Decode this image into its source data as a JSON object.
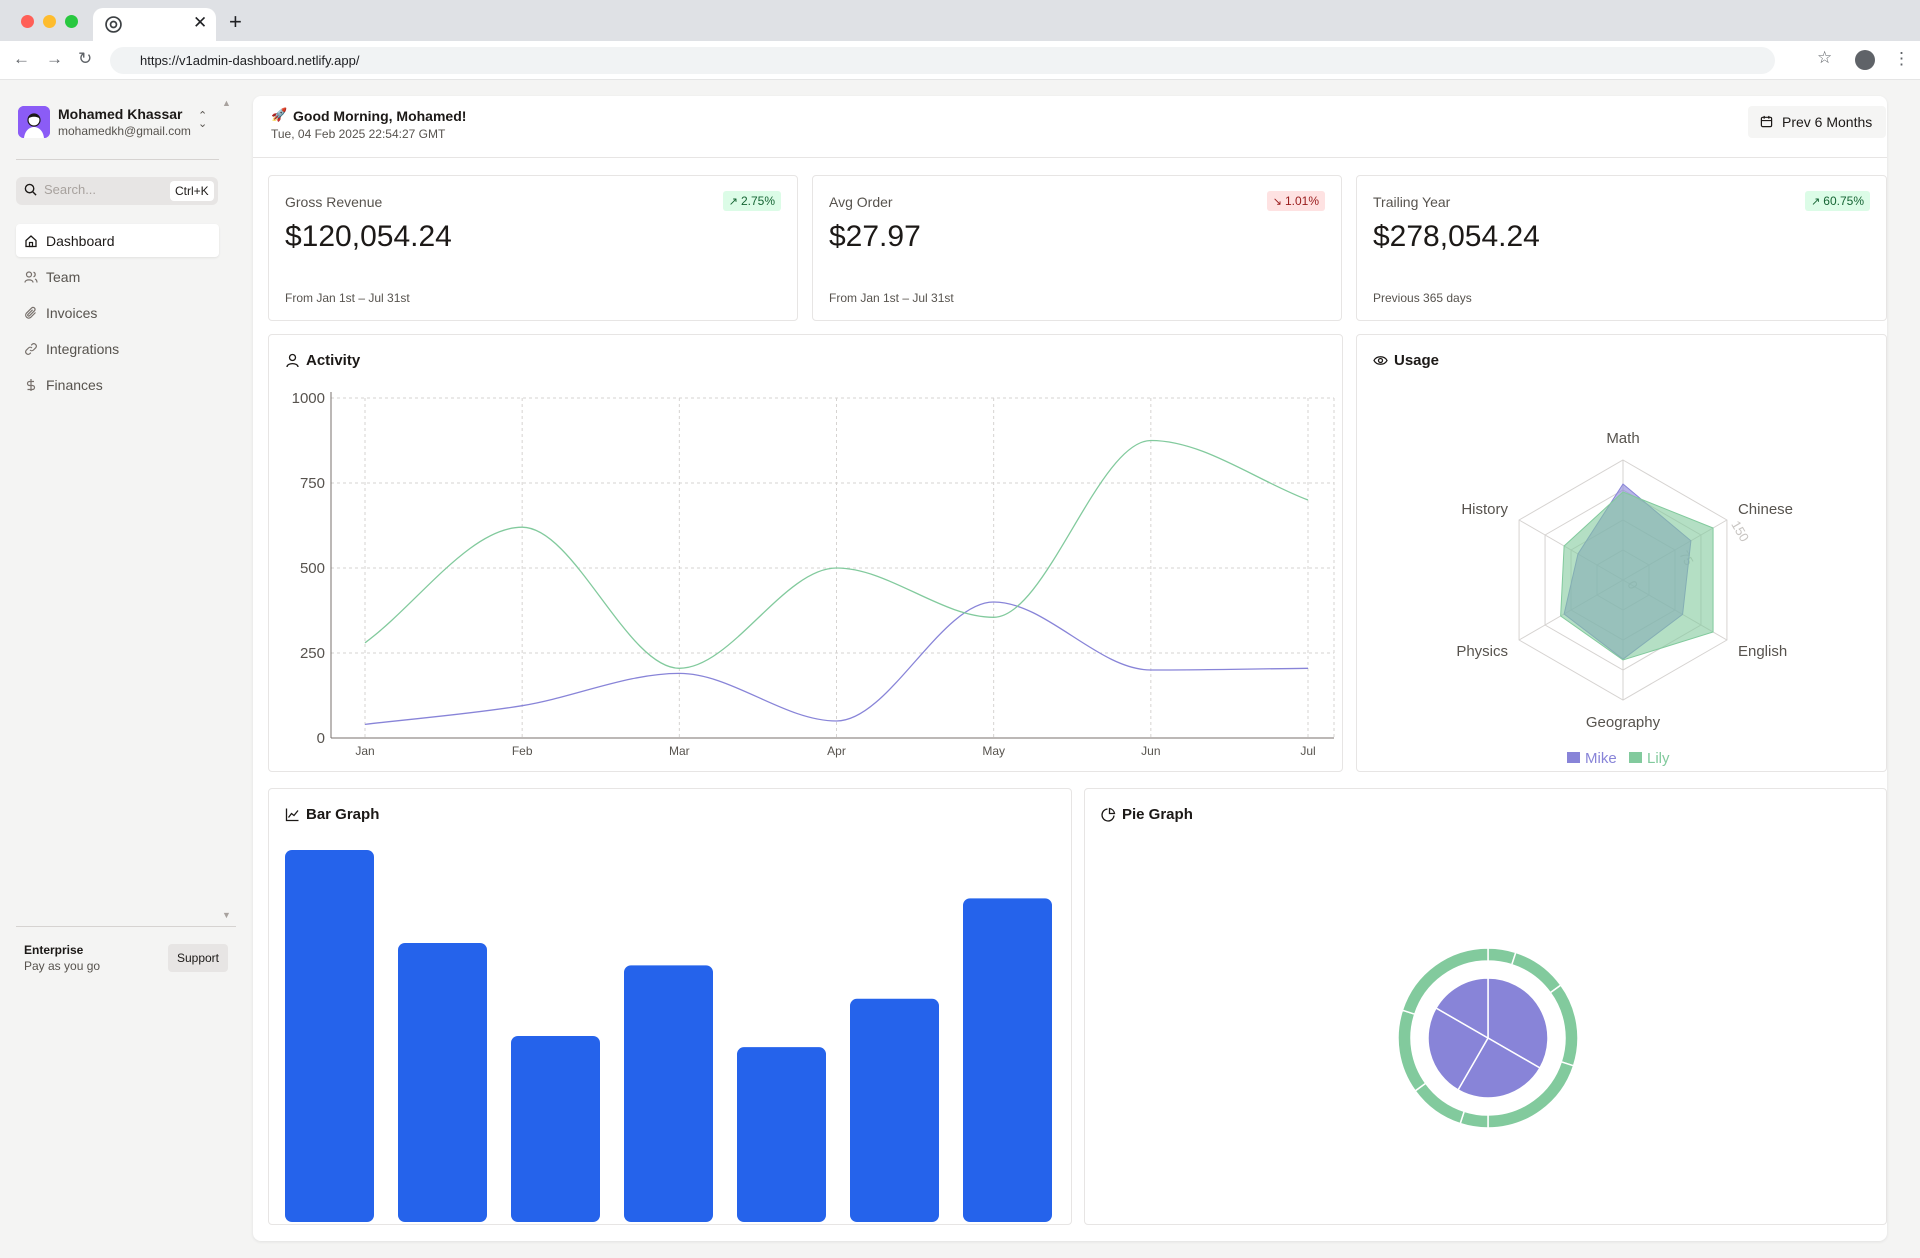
{
  "browser": {
    "url": "https://v1admin-dashboard.netlify.app/",
    "traffic_colors": [
      "#ff5f57",
      "#febc2e",
      "#28c840"
    ]
  },
  "sidebar": {
    "user": {
      "name": "Mohamed Khassar",
      "email": "mohamedkh@gmail.com"
    },
    "search": {
      "placeholder": "Search...",
      "shortcut": "Ctrl+K"
    },
    "items": [
      {
        "label": "Dashboard",
        "icon": "home-icon",
        "active": true
      },
      {
        "label": "Team",
        "icon": "users-icon",
        "active": false
      },
      {
        "label": "Invoices",
        "icon": "paperclip-icon",
        "active": false
      },
      {
        "label": "Integrations",
        "icon": "link-icon",
        "active": false
      },
      {
        "label": "Finances",
        "icon": "dollar-icon",
        "active": false
      }
    ],
    "plan": {
      "title": "Enterprise",
      "subtitle": "Pay as you go",
      "support_label": "Support"
    }
  },
  "header": {
    "greeting": "Good Morning, Mohamed!",
    "date": "Tue, 04 Feb 2025 22:54:27 GMT",
    "range_button": "Prev 6 Months"
  },
  "stats": [
    {
      "label": "Gross Revenue",
      "value": "$120,054.24",
      "note": "From Jan 1st – Jul 31st",
      "change": "2.75%",
      "trend": "up"
    },
    {
      "label": "Avg Order",
      "value": "$27.97",
      "note": "From Jan 1st – Jul 31st",
      "change": "1.01%",
      "trend": "down"
    },
    {
      "label": "Trailing Year",
      "value": "$278,054.24",
      "note": "Previous 365 days",
      "change": "60.75%",
      "trend": "up"
    }
  ],
  "activity": {
    "title": "Activity"
  },
  "usage": {
    "title": "Usage"
  },
  "bar_graph": {
    "title": "Bar Graph"
  },
  "pie_graph": {
    "title": "Pie Graph"
  },
  "colors": {
    "purple": "#8884d8",
    "green": "#82ca9d",
    "blue": "#2563eb"
  },
  "chart_data": [
    {
      "type": "line",
      "x": [
        "Jan",
        "Feb",
        "Mar",
        "Apr",
        "May",
        "Jun",
        "Jul"
      ],
      "ylim": [
        0,
        1000
      ],
      "yticks": [
        0,
        250,
        500,
        750,
        1000
      ],
      "grid": true,
      "series": [
        {
          "values": [
            40,
            95,
            190,
            50,
            400,
            200,
            205
          ],
          "color": "#8884d8"
        },
        {
          "values": [
            280,
            620,
            205,
            500,
            355,
            875,
            700
          ],
          "color": "#82ca9d"
        }
      ]
    },
    {
      "type": "radar",
      "axes": [
        "Math",
        "Chinese",
        "English",
        "Geography",
        "Physics",
        "History"
      ],
      "rlim": [
        0,
        150
      ],
      "rticks": [
        0,
        75,
        150
      ],
      "legend": "bottom",
      "series": [
        {
          "name": "Mike",
          "values": [
            120,
            98,
            86,
            99,
            85,
            65
          ],
          "color": "#8884d8"
        },
        {
          "name": "Lily",
          "values": [
            110,
            130,
            130,
            100,
            90,
            85
          ],
          "color": "#82ca9d"
        }
      ]
    },
    {
      "type": "bar",
      "values": [
        1000,
        750,
        500,
        690,
        470,
        600,
        870
      ],
      "color": "#2563eb"
    },
    {
      "type": "pie",
      "inner": {
        "values": [
          400,
          300,
          300,
          200
        ],
        "color": "#8884d8"
      },
      "outer": {
        "values": [
          100,
          200,
          300,
          400,
          100,
          200,
          300,
          400
        ],
        "color": "#82ca9d"
      }
    }
  ]
}
